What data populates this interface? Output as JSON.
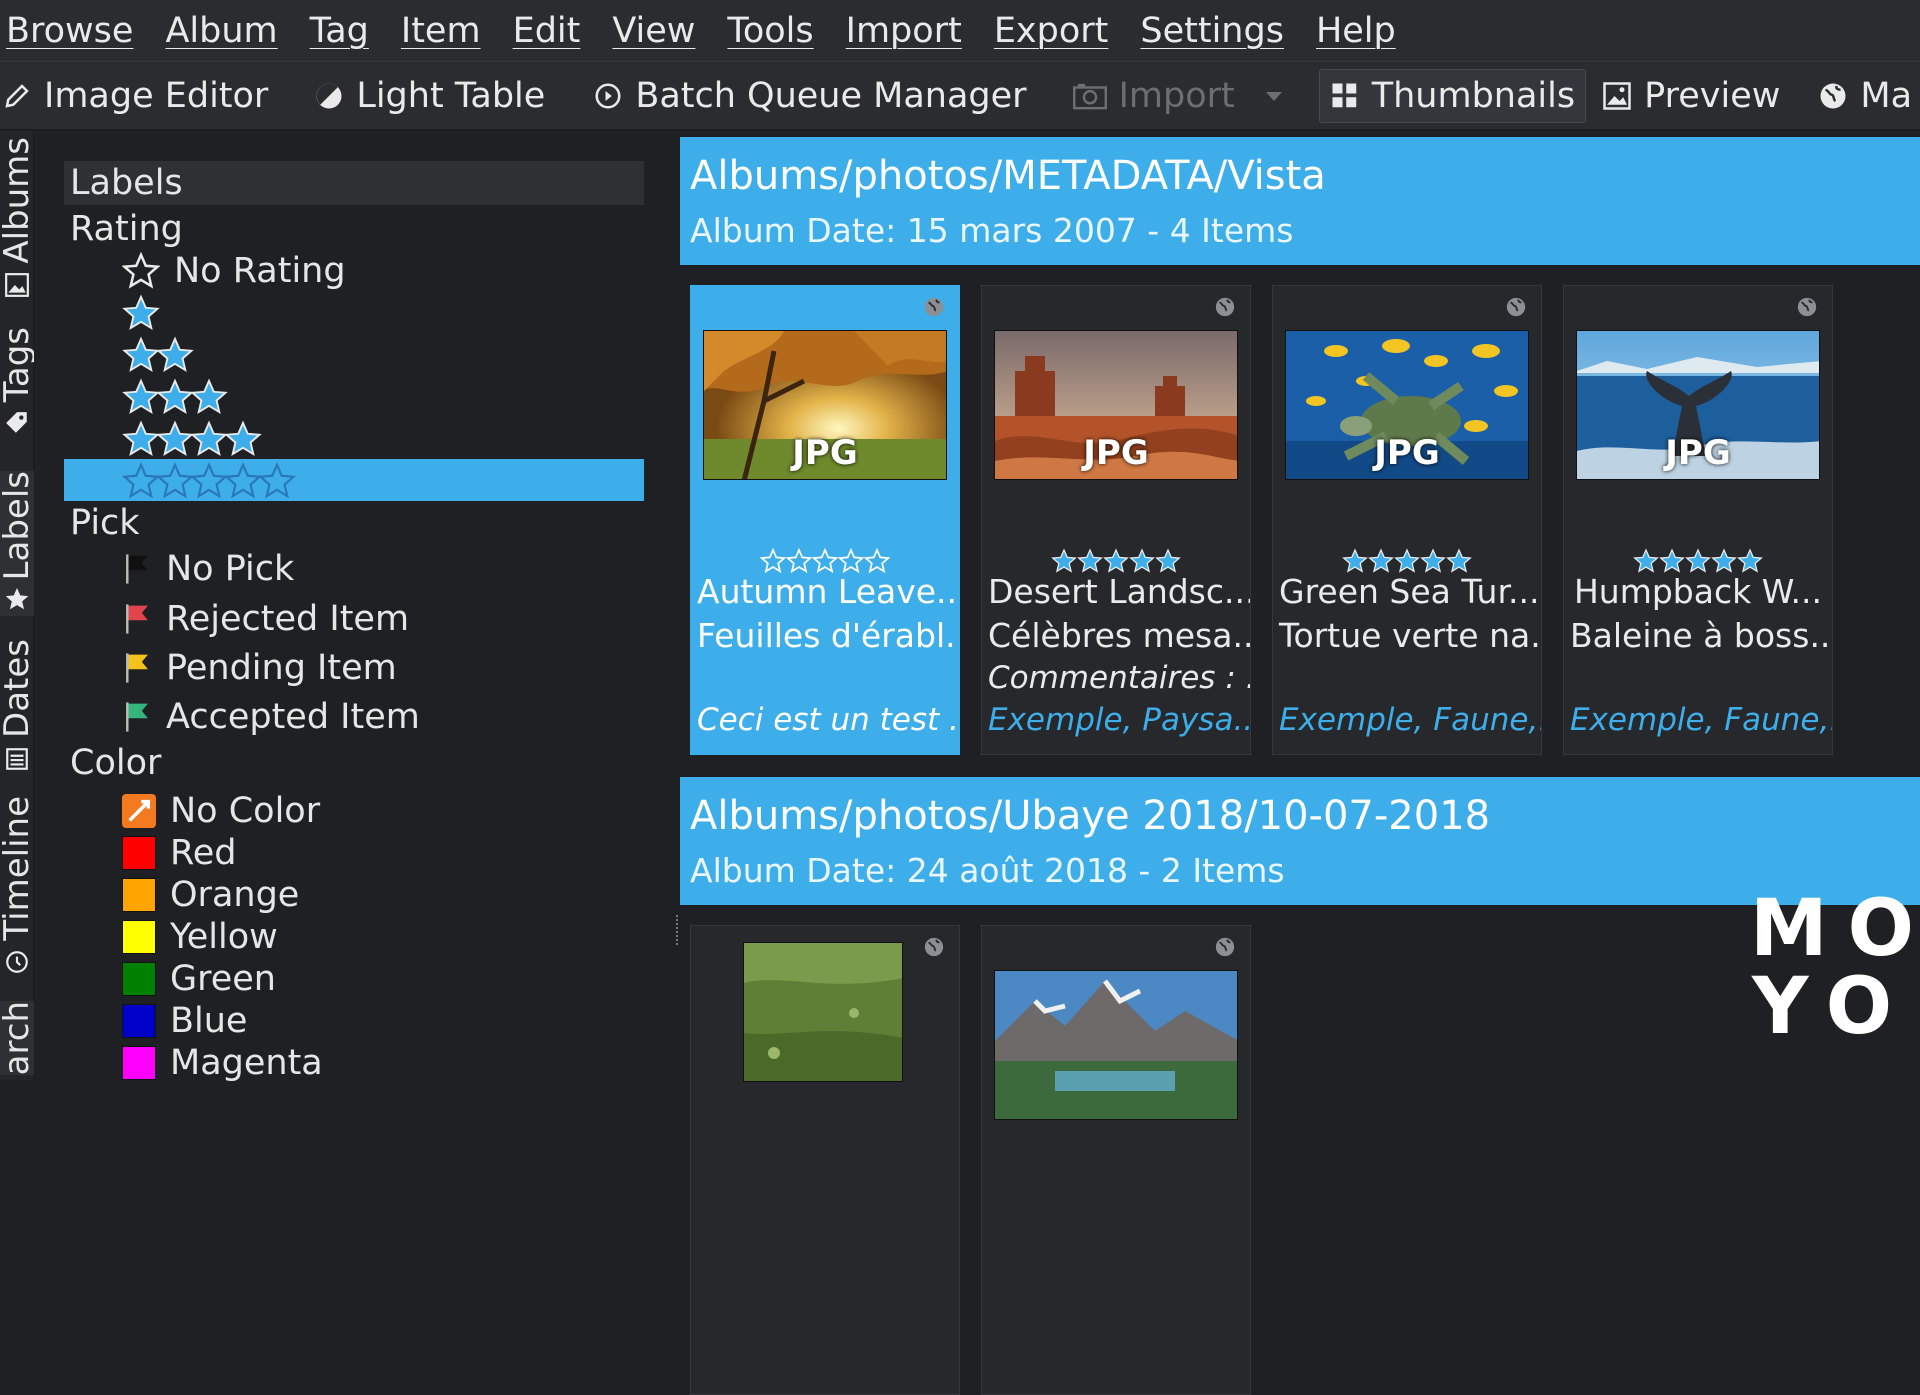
{
  "menu": [
    "Browse",
    "Album",
    "Tag",
    "Item",
    "Edit",
    "View",
    "Tools",
    "Import",
    "Export",
    "Settings",
    "Help"
  ],
  "toolbar": {
    "image_editor": "Image Editor",
    "light_table": "Light Table",
    "batch_queue": "Batch Queue Manager",
    "import": "Import",
    "thumbnails": "Thumbnails",
    "preview": "Preview",
    "map": "Ma"
  },
  "vtabs": {
    "albums": "Albums",
    "tags": "Tags",
    "labels": "Labels",
    "dates": "Dates",
    "timeline": "Timeline",
    "search": "arch"
  },
  "labels": {
    "header": "Labels",
    "rating_title": "Rating",
    "no_rating": "No Rating",
    "ratings": [
      1,
      2,
      3,
      4,
      5
    ],
    "pick_title": "Pick",
    "picks": [
      {
        "label": "No Pick",
        "color": "#111111"
      },
      {
        "label": "Rejected Item",
        "color": "#e0454e"
      },
      {
        "label": "Pending Item",
        "color": "#f3c21c"
      },
      {
        "label": "Accepted Item",
        "color": "#37b37c"
      }
    ],
    "color_title": "Color",
    "colors": [
      {
        "label": "No Color",
        "color": "#f47a20"
      },
      {
        "label": "Red",
        "color": "#ff0000"
      },
      {
        "label": "Orange",
        "color": "#ffa500"
      },
      {
        "label": "Yellow",
        "color": "#ffff00"
      },
      {
        "label": "Green",
        "color": "#008000"
      },
      {
        "label": "Blue",
        "color": "#0000c8"
      },
      {
        "label": "Magenta",
        "color": "#ff00ff"
      }
    ]
  },
  "albums": [
    {
      "title": "Albums/photos/METADATA/Vista",
      "subtitle": "Album Date: 15 mars 2007 - 4 Items",
      "items": [
        {
          "name": "Autumn Leave...",
          "caption": "Feuilles d'érabl...",
          "comment": "",
          "tags": "Ceci est un test ...",
          "badge": "JPG"
        },
        {
          "name": "Desert Landsc...",
          "caption": "Célèbres mesa...",
          "comment": "Commentaires : ...",
          "tags": "Exemple, Paysa...",
          "badge": "JPG"
        },
        {
          "name": "Green Sea Tur...",
          "caption": "Tortue verte na...",
          "comment": "",
          "tags": "Exemple, Faune,...",
          "badge": "JPG"
        },
        {
          "name": "Humpback W...",
          "caption": "Baleine à boss...",
          "comment": "",
          "tags": "Exemple, Faune,...",
          "badge": "JPG"
        }
      ]
    },
    {
      "title": "Albums/photos/Ubaye 2018/10-07-2018",
      "subtitle": "Album Date: 24 août 2018 - 2 Items",
      "items": []
    }
  ],
  "watermark": {
    "line1": "MO",
    "line2": "YO"
  },
  "accent": "#3daee9"
}
